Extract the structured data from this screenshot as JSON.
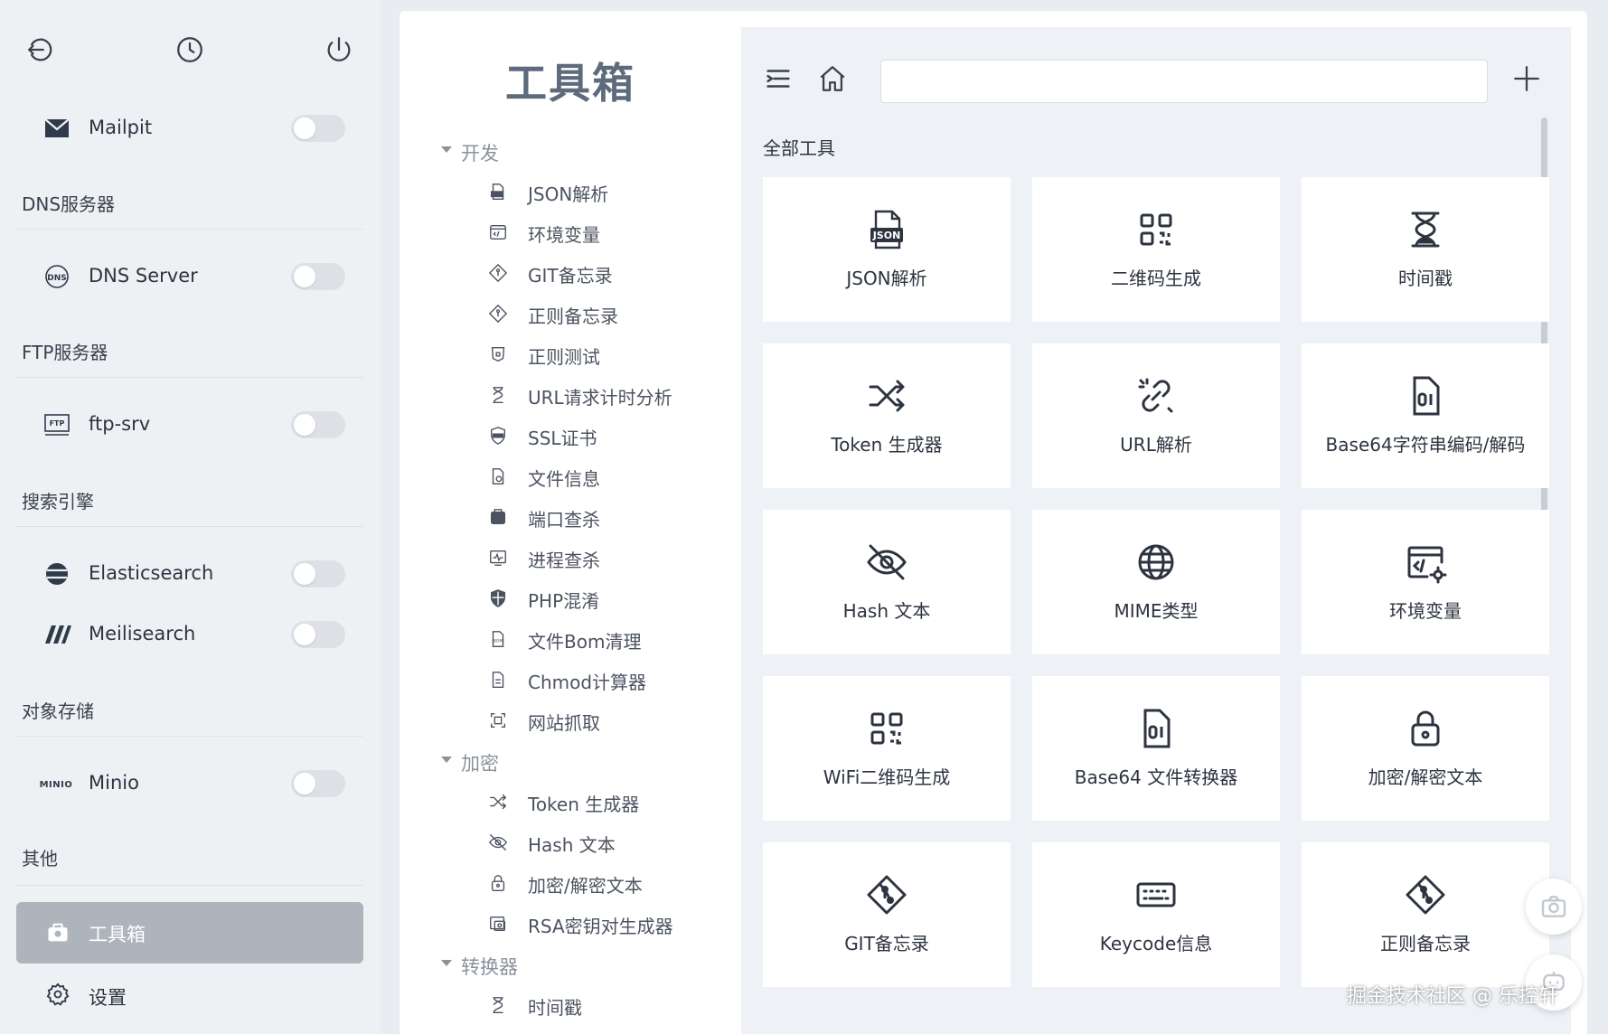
{
  "sidebar": {
    "top_icons": [
      "logout-icon",
      "history-icon",
      "power-icon"
    ],
    "services": [
      {
        "label": "Mailpit",
        "icon": "mailpit-icon",
        "enabled": false
      },
      {
        "label": "DNS Server",
        "icon": "dns-icon",
        "enabled": false
      },
      {
        "label": "ftp-srv",
        "icon": "ftp-icon",
        "enabled": false
      },
      {
        "label": "Elasticsearch",
        "icon": "elasticsearch-icon",
        "enabled": false
      },
      {
        "label": "Meilisearch",
        "icon": "meilisearch-icon",
        "enabled": false
      },
      {
        "label": "Minio",
        "icon": "minio-icon",
        "enabled": false
      }
    ],
    "groups": [
      "DNS服务器",
      "FTP服务器",
      "搜索引擎",
      "对象存储",
      "其他"
    ],
    "nav": {
      "toolbox": "工具箱",
      "settings": "设置"
    }
  },
  "tree": {
    "title": "工具箱",
    "groups": [
      {
        "label": "开发",
        "items": [
          "JSON解析",
          "环境变量",
          "GIT备忘录",
          "正则备忘录",
          "正则测试",
          "URL请求计时分析",
          "SSL证书",
          "文件信息",
          "端口查杀",
          "进程查杀",
          "PHP混淆",
          "文件Bom清理",
          "Chmod计算器",
          "网站抓取"
        ]
      },
      {
        "label": "加密",
        "items": [
          "Token 生成器",
          "Hash 文本",
          "加密/解密文本",
          "RSA密钥对生成器"
        ]
      },
      {
        "label": "转换器",
        "items": [
          "时间戳"
        ]
      }
    ]
  },
  "content": {
    "search": {
      "value": "",
      "placeholder": ""
    },
    "section_title": "全部工具",
    "cards": [
      {
        "label": "JSON解析",
        "icon": "json-file-icon"
      },
      {
        "label": "二维码生成",
        "icon": "qrcode-icon"
      },
      {
        "label": "时间戳",
        "icon": "hourglass-icon"
      },
      {
        "label": "Token 生成器",
        "icon": "shuffle-icon"
      },
      {
        "label": "URL解析",
        "icon": "link-broken-icon"
      },
      {
        "label": "Base64字符串编码/解码",
        "icon": "binary-file-icon"
      },
      {
        "label": "Hash 文本",
        "icon": "eye-off-icon"
      },
      {
        "label": "MIME类型",
        "icon": "globe-icon"
      },
      {
        "label": "环境变量",
        "icon": "code-settings-icon"
      },
      {
        "label": "WiFi二维码生成",
        "icon": "qrcode-icon"
      },
      {
        "label": "Base64 文件转换器",
        "icon": "binary-file-icon"
      },
      {
        "label": "加密/解密文本",
        "icon": "lock-icon"
      },
      {
        "label": "GIT备忘录",
        "icon": "git-icon"
      },
      {
        "label": "Keycode信息",
        "icon": "keyboard-icon"
      },
      {
        "label": "正则备忘录",
        "icon": "git-icon"
      }
    ]
  },
  "watermark": "掘金技术社区 @ 乐控轩"
}
